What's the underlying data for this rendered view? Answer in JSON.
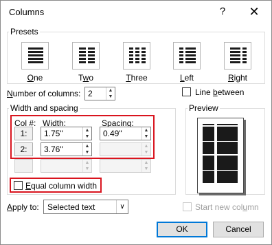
{
  "dialog": {
    "title": "Columns",
    "help_glyph": "?",
    "close_glyph": "✕"
  },
  "presets": {
    "group_label": "Presets",
    "items": [
      {
        "label_pre": "",
        "label_u": "O",
        "label_post": "ne",
        "icon": "one-column-icon"
      },
      {
        "label_pre": "T",
        "label_u": "w",
        "label_post": "o",
        "icon": "two-columns-icon"
      },
      {
        "label_pre": "",
        "label_u": "T",
        "label_post": "hree",
        "icon": "three-columns-icon"
      },
      {
        "label_pre": "",
        "label_u": "L",
        "label_post": "eft",
        "icon": "left-columns-icon"
      },
      {
        "label_pre": "",
        "label_u": "R",
        "label_post": "ight",
        "icon": "right-columns-icon"
      }
    ]
  },
  "num_columns": {
    "label_u": "N",
    "label_post": "umber of columns:",
    "value": "2"
  },
  "line_between": {
    "label_pre": "Line ",
    "label_u": "b",
    "label_post": "etween",
    "checked": false
  },
  "width_spacing": {
    "group_label": "Width and spacing",
    "col_header_u": "C",
    "col_header_post": "ol #:",
    "width_header_pre": "W",
    "width_header_u": "i",
    "width_header_post": "dth:",
    "spacing_header_u": "S",
    "spacing_header_post": "pacing:",
    "rows": [
      {
        "col": "1:",
        "width": "1.75\"",
        "spacing": "0.49\""
      },
      {
        "col": "2:",
        "width": "3.76\"",
        "spacing": ""
      },
      {
        "col": "",
        "width": "",
        "spacing": ""
      }
    ]
  },
  "equal_width": {
    "label_u": "E",
    "label_post": "qual column width",
    "checked": false
  },
  "preview": {
    "group_label": "Preview"
  },
  "apply_to": {
    "label_pre": "",
    "label_u": "A",
    "label_post": "pply to:",
    "value": "Selected text"
  },
  "start_new_column": {
    "label_pre": "Start new col",
    "label_u": "u",
    "label_post": "mn",
    "checked": false
  },
  "buttons": {
    "ok": "OK",
    "cancel": "Cancel"
  },
  "colors": {
    "highlight": "#d9141e",
    "default_button_border": "#0078d7"
  }
}
